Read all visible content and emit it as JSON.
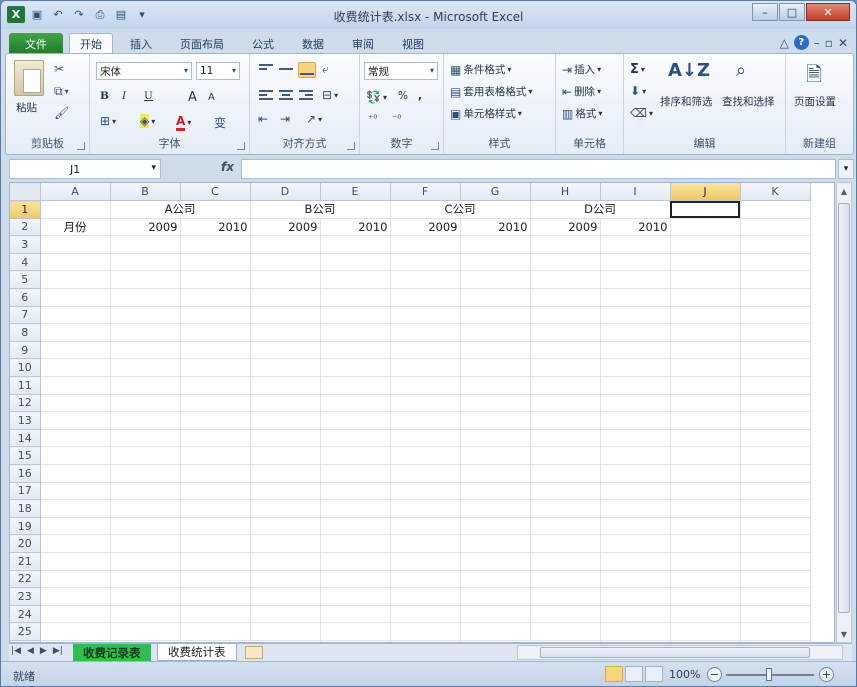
{
  "window": {
    "title": "收费统计表.xlsx - Microsoft Excel"
  },
  "quick_access": [
    "save-icon",
    "undo-icon",
    "redo-icon",
    "customize-icon"
  ],
  "ribbon_tabs": [
    {
      "label": "文件"
    },
    {
      "label": "开始"
    },
    {
      "label": "插入"
    },
    {
      "label": "页面布局"
    },
    {
      "label": "公式"
    },
    {
      "label": "数据"
    },
    {
      "label": "审阅"
    },
    {
      "label": "视图"
    }
  ],
  "ribbon": {
    "clipboard": {
      "label": "剪贴板",
      "paste": "粘贴"
    },
    "font": {
      "label": "字体",
      "name": "宋体",
      "size": "11",
      "bold": "B",
      "italic": "I",
      "underline": "U",
      "grow": "A",
      "shrink": "A",
      "wen": "变"
    },
    "alignment": {
      "label": "对齐方式"
    },
    "number": {
      "label": "数字",
      "format": "常规",
      "percent": "%",
      "comma": ","
    },
    "styles": {
      "label": "样式",
      "conditional": "条件格式",
      "table": "套用表格格式",
      "cell": "单元格样式"
    },
    "cells": {
      "label": "单元格",
      "insert": "插入",
      "delete": "删除",
      "format": "格式"
    },
    "editing": {
      "label": "编辑",
      "sort": "排序和筛选",
      "find": "查找和选择",
      "sigma": "Σ"
    },
    "newgroup": {
      "label": "新建组",
      "page_setup": "页面设置"
    }
  },
  "formula_bar": {
    "name_box": "J1",
    "fx": "fx",
    "value": ""
  },
  "grid": {
    "columns": [
      "A",
      "B",
      "C",
      "D",
      "E",
      "F",
      "G",
      "H",
      "I",
      "J",
      "K"
    ],
    "selected_column": "J",
    "selected_row": 1,
    "row_count": 26,
    "row1": {
      "B": "A公司",
      "D": "B公司",
      "F": "C公司",
      "H": "D公司"
    },
    "row2": {
      "A": "月份",
      "B": "2009",
      "C": "2010",
      "D": "2009",
      "E": "2010",
      "F": "2009",
      "G": "2010",
      "H": "2009",
      "I": "2010"
    }
  },
  "sheet_tabs": [
    {
      "label": "收费记录表",
      "color": "#2fbf4f"
    },
    {
      "label": "收费统计表",
      "active": true
    }
  ],
  "status": {
    "text": "就绪",
    "zoom": "100%"
  }
}
